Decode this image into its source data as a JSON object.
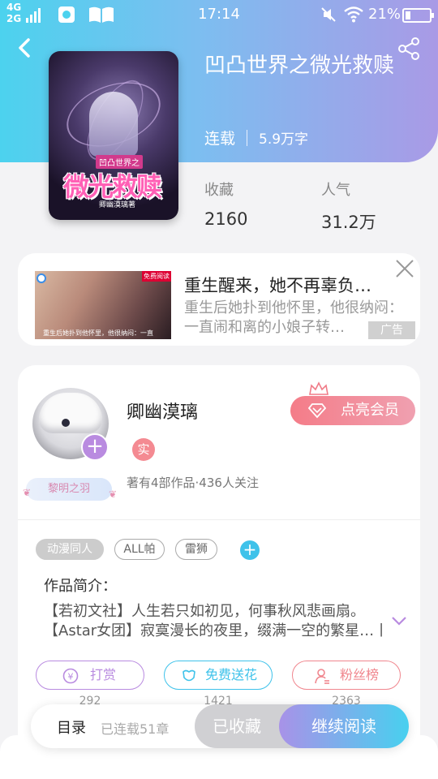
{
  "status_bar": {
    "network_top": "4G",
    "network_bottom": "2G",
    "time": "17:14",
    "battery_percent": "21%",
    "battery_level": 0.21,
    "icons": [
      "signal-icon",
      "app-icon",
      "book-icon",
      "mute-icon",
      "wifi-icon",
      "battery-icon"
    ]
  },
  "header": {
    "back_icon": "chevron-left-icon",
    "share_icon": "share-icon",
    "gradient_colors": [
      "#4cd2ee",
      "#a99ae6"
    ]
  },
  "book": {
    "title": "凹凸世界之微光救赎",
    "status": "连载",
    "word_count": "5.9万字",
    "cover": {
      "series_label": "凹凸世界之",
      "title_art": "微光救赎",
      "author_line": "卿幽漠璃著"
    },
    "stats": [
      {
        "label": "收藏",
        "value": "2160"
      },
      {
        "label": "人气",
        "value": "31.2万"
      }
    ]
  },
  "ad": {
    "title": "重生醒来，她不再辜负…",
    "description": "重生后她扑到他怀里，他很纳闷：一直闹和离的小娘子转…",
    "label": "广告",
    "image_tag": "免费阅读",
    "image_caption": "重生后她扑到他怀里，他很纳闷：一直"
  },
  "author": {
    "name": "卿幽漠璃",
    "badge": "黎明之羽",
    "real_badge": "实",
    "stats_text": "著有4部作品·436人关注",
    "follow_label": "+",
    "vip_button": "点亮会员"
  },
  "tags": [
    {
      "label": "动漫同人",
      "style": "filled"
    },
    {
      "label": "ALL帕",
      "style": "outline"
    },
    {
      "label": "雷狮",
      "style": "outline"
    }
  ],
  "add_tag_label": "+",
  "intro": {
    "label": "作品简介：",
    "line1": "【若初文社】人生若只如初见，何事秋风悲画扇。",
    "line2": "【Astar女团】寂寞漫长的夜里，缀满一空的繁星…丨"
  },
  "actions": [
    {
      "label": "打赏",
      "count": "292",
      "color": "#b98be0"
    },
    {
      "label": "免费送花",
      "count": "1421",
      "color": "#3ec2ea"
    },
    {
      "label": "粉丝榜",
      "count": "2363",
      "color": "#f0868e"
    }
  ],
  "bottom_bar": {
    "toc_label": "目录",
    "toc_count": "已连载51章",
    "collected_label": "已收藏",
    "continue_label": "继续阅读"
  }
}
